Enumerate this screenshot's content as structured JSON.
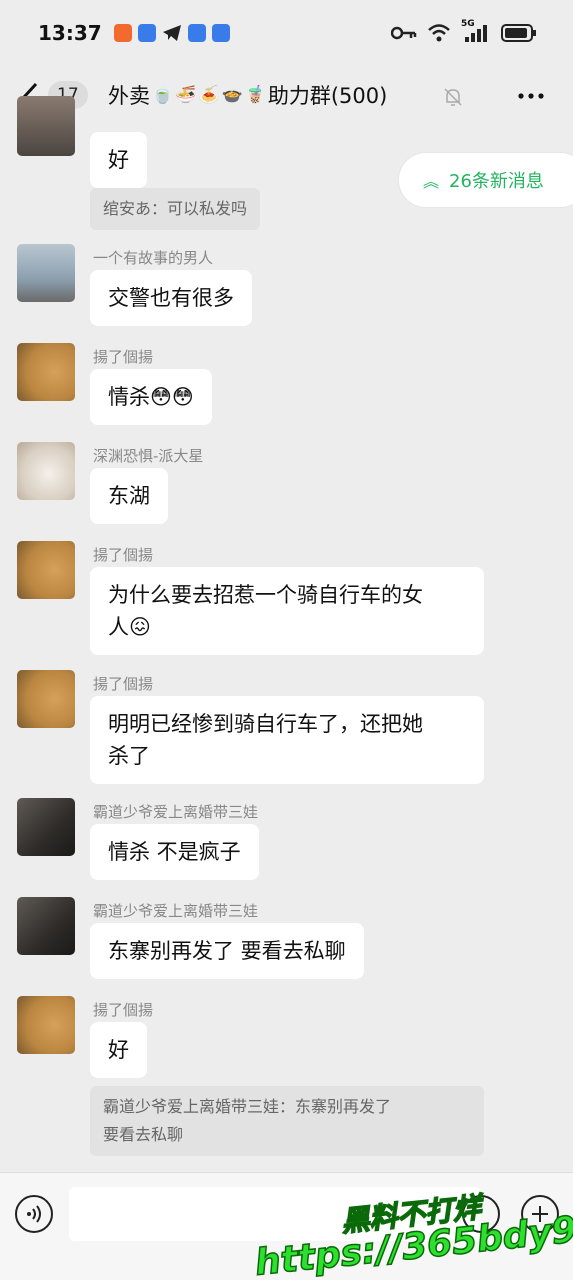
{
  "status_bar": {
    "time": "13:37",
    "network": "5G"
  },
  "header": {
    "unread_count": "17",
    "title_prefix": "外卖",
    "title_emojis": [
      "🍵",
      "🍜",
      "🍝",
      "🍲",
      "🧋"
    ],
    "title_suffix": "助力群(500)"
  },
  "new_messages_pill": {
    "label": "26条新消息"
  },
  "messages": [
    {
      "sender": "",
      "text": "好",
      "quote": "绾安あ：可以私发吗"
    },
    {
      "sender": "一个有故事的男人",
      "text": "交警也有很多"
    },
    {
      "sender": "揚了個揚",
      "text": "情杀😳😳"
    },
    {
      "sender": "深渊恐惧-派大星",
      "text": "东湖"
    },
    {
      "sender": "揚了個揚",
      "text_line1": "为什么要去招惹一个骑自行车的女",
      "text_line2": "人😖"
    },
    {
      "sender": "揚了個揚",
      "text_line1": "明明已经惨到骑自行车了，还把她",
      "text_line2": "杀了"
    },
    {
      "sender": "霸道少爷爱上离婚带三娃",
      "text": "情杀 不是疯子"
    },
    {
      "sender": "霸道少爷爱上离婚带三娃",
      "text": "东寨别再发了 要看去私聊"
    },
    {
      "sender": "揚了個揚",
      "text": "好",
      "quote_line1": "霸道少爷爱上离婚带三娃：东寨别再发了",
      "quote_line2": "要看去私聊"
    }
  ],
  "input_bar": {
    "placeholder": ""
  },
  "watermark": {
    "line1": "黑料不打烊",
    "line2": "https://365bdy9.com"
  },
  "colors": {
    "background": "#ededed",
    "accent_green": "#24b35e",
    "bubble": "#ffffff"
  }
}
